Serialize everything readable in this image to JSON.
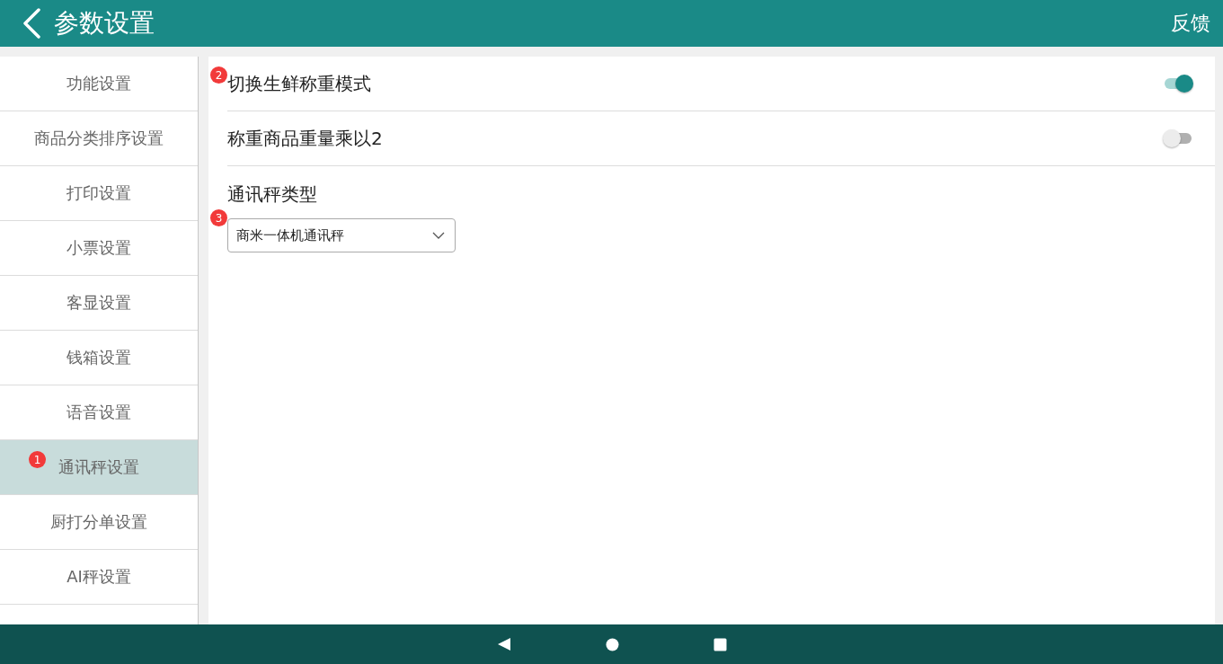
{
  "header": {
    "title": "参数设置",
    "action": "反馈"
  },
  "sidebar": {
    "items": [
      {
        "label": "功能设置",
        "selected": false
      },
      {
        "label": "商品分类排序设置",
        "selected": false
      },
      {
        "label": "打印设置",
        "selected": false
      },
      {
        "label": "小票设置",
        "selected": false
      },
      {
        "label": "客显设置",
        "selected": false
      },
      {
        "label": "钱箱设置",
        "selected": false
      },
      {
        "label": "语音设置",
        "selected": false
      },
      {
        "label": "通讯秤设置",
        "selected": true,
        "badge": "1"
      },
      {
        "label": "厨打分单设置",
        "selected": false
      },
      {
        "label": "AI秤设置",
        "selected": false
      }
    ]
  },
  "settings": [
    {
      "kind": "toggle",
      "label": "切换生鲜称重模式",
      "on": true,
      "badge": "2"
    },
    {
      "kind": "toggle",
      "label": "称重商品重量乘以2",
      "on": false
    },
    {
      "kind": "select",
      "label": "通讯秤类型",
      "value": "商米一体机通讯秤",
      "badge": "3"
    }
  ]
}
